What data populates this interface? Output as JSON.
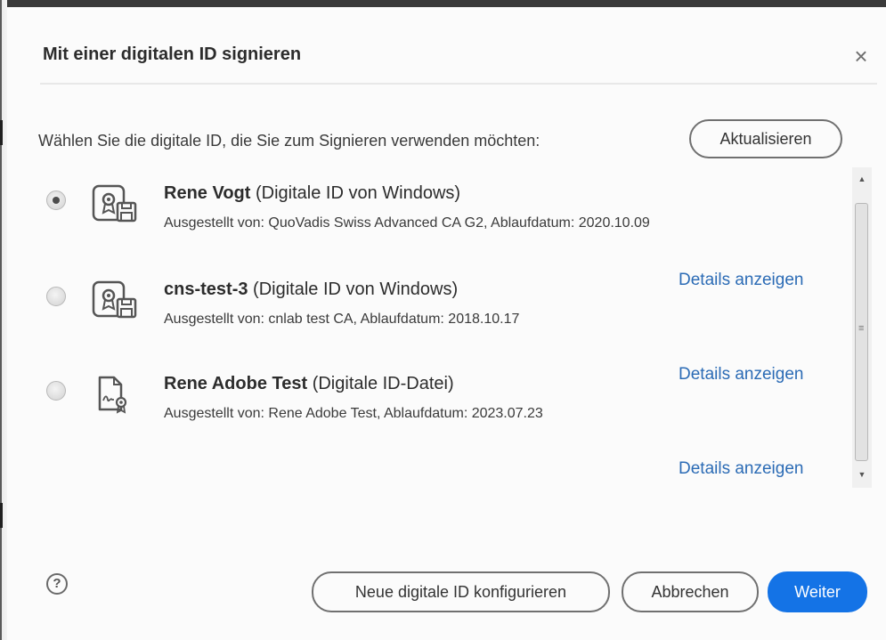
{
  "dialog": {
    "title": "Mit einer digitalen ID signieren",
    "close_icon": "close-icon"
  },
  "prompt": "Wählen Sie die digitale ID, die Sie zum Signieren verwenden möchten:",
  "refresh_label": "Aktualisieren",
  "ids": [
    {
      "name": "Rene Vogt",
      "type": "(Digitale ID von Windows)",
      "issued": "Ausgestellt von: QuoVadis Swiss Advanced CA G2, Ablaufdatum: 2020.10.09",
      "selected": true,
      "icon": "certificate-floppy-icon"
    },
    {
      "name": "cns-test-3",
      "type": "(Digitale ID von Windows)",
      "issued": "Ausgestellt von: cnlab test CA, Ablaufdatum: 2018.10.17",
      "selected": false,
      "icon": "certificate-floppy-icon",
      "details": "Details anzeigen"
    },
    {
      "name": "Rene Adobe Test",
      "type": "(Digitale ID-Datei)",
      "issued": "Ausgestellt von: Rene Adobe Test, Ablaufdatum: 2023.07.23",
      "selected": false,
      "icon": "signed-document-icon",
      "details": "Details anzeigen"
    }
  ],
  "last_details": "Details anzeigen",
  "footer": {
    "help_icon": "help-icon",
    "help_glyph": "?",
    "new_id_label": "Neue digitale ID konfigurieren",
    "cancel_label": "Abbrechen",
    "next_label": "Weiter"
  },
  "colors": {
    "accent": "#1473e6",
    "link": "#2b6bb5"
  }
}
